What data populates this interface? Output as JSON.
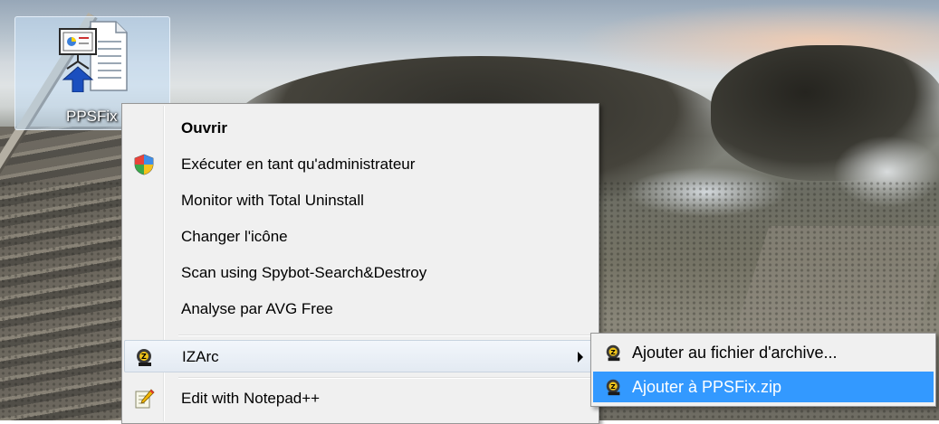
{
  "desktop": {
    "icon": {
      "label": "PPSFix",
      "icon": "powerpoint-show-document-icon"
    }
  },
  "context_menu": {
    "items": [
      {
        "label": "Ouvrir",
        "icon": null,
        "bold": true
      },
      {
        "label": "Exécuter en tant qu'administrateur",
        "icon": "uac-shield-icon"
      },
      {
        "label": "Monitor with Total Uninstall",
        "icon": null
      },
      {
        "label": "Changer l'icône",
        "icon": null
      },
      {
        "label": "Scan using Spybot-Search&Destroy",
        "icon": null
      },
      {
        "label": "Analyse par AVG Free",
        "icon": null
      },
      {
        "label": "IZArc",
        "icon": "izarc-icon",
        "has_submenu": true,
        "highlighted": true
      },
      {
        "label": "Edit with Notepad++",
        "icon": "notepad-plus-plus-icon"
      }
    ]
  },
  "submenu": {
    "items": [
      {
        "label": "Ajouter au fichier d'archive...",
        "icon": "izarc-icon"
      },
      {
        "label": "Ajouter à PPSFix.zip",
        "icon": "izarc-icon",
        "selected": true
      }
    ],
    "selected_color": "#3399ff"
  }
}
